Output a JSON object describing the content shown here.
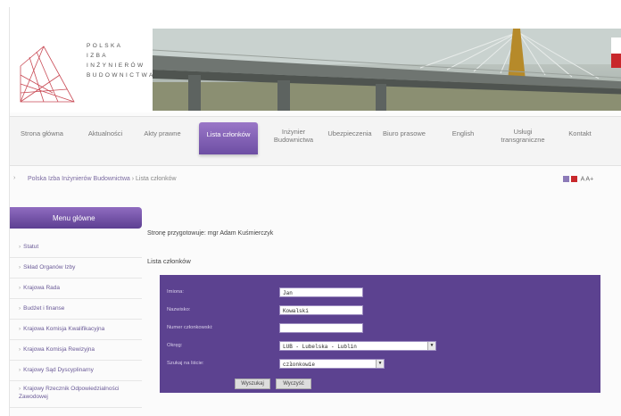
{
  "logo": {
    "lines": [
      "POLSKA",
      "IZBA",
      "INŻYNIERÓW",
      "BUDOWNICTWA"
    ]
  },
  "nav": {
    "items": [
      {
        "label": "Strona główna"
      },
      {
        "label": "Aktualności"
      },
      {
        "label": "Akty prawne"
      },
      {
        "label": "Lista członków"
      },
      {
        "label": "Inżynier Budownictwa"
      },
      {
        "label": "Ubezpieczenia"
      },
      {
        "label": "Biuro prasowe"
      },
      {
        "label": "English"
      },
      {
        "label": "Usługi transgraniczne"
      },
      {
        "label": "Kontakt"
      }
    ]
  },
  "breadcrumb": {
    "home": "Polska Izba Inżynierów Budownictwa",
    "separator": "›",
    "current": "Lista członków"
  },
  "font_tools": {
    "small": "A",
    "large": "A+"
  },
  "sidebar": {
    "title": "Menu główne",
    "items": [
      {
        "label": "Statut"
      },
      {
        "label": "Skład Organów Izby"
      },
      {
        "label": "Krajowa Rada"
      },
      {
        "label": "Budżet i finanse"
      },
      {
        "label": "Krajowa Komisja Kwalifikacyjna"
      },
      {
        "label": "Krajowa Komisja Rewizyjna"
      },
      {
        "label": "Krajowy Sąd Dyscyplinarny"
      },
      {
        "label": "Krajowy Rzecznik Odpowiedzialności Zawodowej"
      }
    ]
  },
  "main": {
    "author": "Stronę przygotowuje: mgr Adam Kuśmierczyk",
    "list_title": "Lista członków",
    "form": {
      "fields": [
        {
          "label": "Imiona:",
          "value": "Jan"
        },
        {
          "label": "Nazwisko:",
          "value": "Kowalski"
        },
        {
          "label": "Numer członkowski:",
          "value": ""
        },
        {
          "label": "Okręg:",
          "value": "LUB - Lubelska - Lublin"
        },
        {
          "label": "Szukaj na liście:",
          "value": "członkowie"
        }
      ],
      "search_button": "Wyszukaj",
      "clear_button": "Wyczyść"
    }
  },
  "colors": {
    "accent": "#6d4ea4",
    "form_bg": "#5c4290",
    "link": "#6a5a97",
    "flag_red": "#c8282c"
  }
}
